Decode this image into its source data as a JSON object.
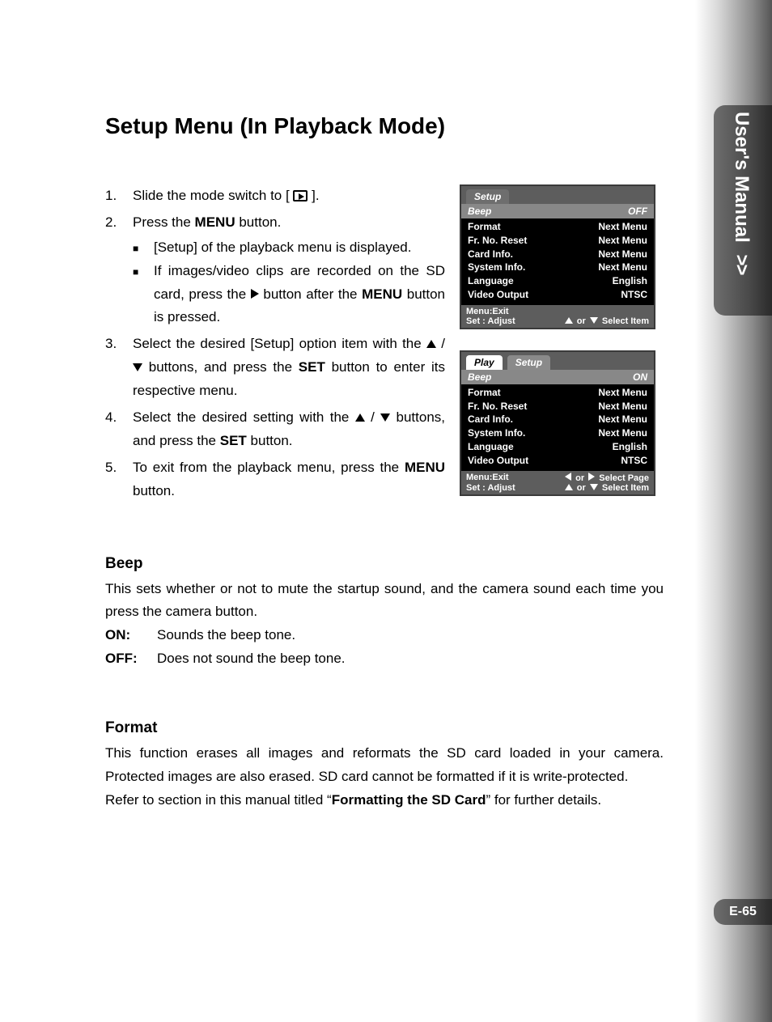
{
  "side_tab": {
    "label": "User's Manual",
    "chevrons": ">>"
  },
  "page_number": "E-65",
  "heading": "Setup Menu (In Playback Mode)",
  "steps": [
    {
      "n": "1.",
      "text_before": "Slide the mode switch to [ ",
      "text_after": " ]."
    },
    {
      "n": "2.",
      "text": "Press the ",
      "bold1": "MENU",
      "text2": " button.",
      "sub": [
        {
          "text": "[Setup] of the playback menu is displayed."
        },
        {
          "t1": "If images/video clips are recorded on the SD card, press the ",
          "t2": " button after the ",
          "b2": "MENU",
          "t3": " button is pressed."
        }
      ]
    },
    {
      "n": "3.",
      "t1": "Select the desired [Setup] option item with the ",
      "t2": " / ",
      "t3": " buttons, and press the ",
      "b3": "SET",
      "t4": " button to enter its respective menu."
    },
    {
      "n": "4.",
      "t1": "Select the desired setting with the ",
      "t2": " / ",
      "t3": " buttons, and press the ",
      "b3": "SET",
      "t4": " button."
    },
    {
      "n": "5.",
      "t1": "To exit from the playback menu, press the ",
      "b1": "MENU",
      "t2": " button."
    }
  ],
  "lcd1": {
    "tab": "Setup",
    "highlight": {
      "label": "Beep",
      "value": "OFF"
    },
    "rows": [
      {
        "label": "Format",
        "value": "Next Menu"
      },
      {
        "label": "Fr. No. Reset",
        "value": "Next Menu"
      },
      {
        "label": "Card Info.",
        "value": "Next Menu"
      },
      {
        "label": "System Info.",
        "value": "Next Menu"
      },
      {
        "label": "Language",
        "value": "English"
      },
      {
        "label": "Video Output",
        "value": "NTSC"
      }
    ],
    "footer": {
      "line1_l": "Menu:Exit",
      "line2_l": "Set : Adjust",
      "line2_r_mid": "or",
      "line2_r_end": "Select Item"
    }
  },
  "lcd2": {
    "tab_inactive": "Play",
    "tab_active": "Setup",
    "highlight": {
      "label": "Beep",
      "value": "ON"
    },
    "rows": [
      {
        "label": "Format",
        "value": "Next Menu"
      },
      {
        "label": "Fr. No. Reset",
        "value": "Next Menu"
      },
      {
        "label": "Card Info.",
        "value": "Next Menu"
      },
      {
        "label": "System Info.",
        "value": "Next Menu"
      },
      {
        "label": "Language",
        "value": "English"
      },
      {
        "label": "Video Output",
        "value": "NTSC"
      }
    ],
    "footer": {
      "line1_l": "Menu:Exit",
      "line1_r_mid": "or",
      "line1_r_end": "Select Page",
      "line2_l": "Set : Adjust",
      "line2_r_mid": "or",
      "line2_r_end": "Select Item"
    }
  },
  "beep_section": {
    "title": "Beep",
    "desc": "This sets whether or not to mute the startup sound, and the camera sound each time you press the camera button.",
    "rows": [
      {
        "term": "ON:",
        "def": "Sounds the beep tone."
      },
      {
        "term": "OFF:",
        "def": "Does not sound the beep tone."
      }
    ]
  },
  "format_section": {
    "title": "Format",
    "p1": "This function erases all images and reformats the SD card loaded in your camera. Protected images are also erased. SD card cannot be formatted if it is write-protected.",
    "p2_a": "Refer to section in this manual titled “",
    "p2_bold": "Formatting the SD Card",
    "p2_b": "” for further details."
  }
}
